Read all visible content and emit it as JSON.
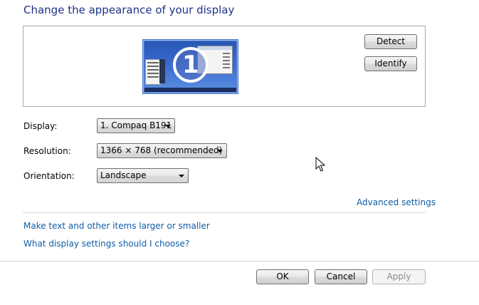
{
  "page": {
    "title": "Change the appearance of your display"
  },
  "preview": {
    "monitor_number": "1",
    "detect_label": "Detect",
    "identify_label": "Identify"
  },
  "settings": {
    "display_label": "Display:",
    "display_value": "1. Compaq B191",
    "resolution_label": "Resolution:",
    "resolution_value": "1366 × 768 (recommended)",
    "orientation_label": "Orientation:",
    "orientation_value": "Landscape"
  },
  "links": {
    "advanced": "Advanced settings",
    "text_size": "Make text and other items larger or smaller",
    "help": "What display settings should I choose?"
  },
  "footer": {
    "ok_label": "OK",
    "cancel_label": "Cancel",
    "apply_label": "Apply"
  },
  "colors": {
    "title": "#1e3287",
    "link": "#0f5ca8",
    "monitor_border": "#3d6fc9"
  }
}
